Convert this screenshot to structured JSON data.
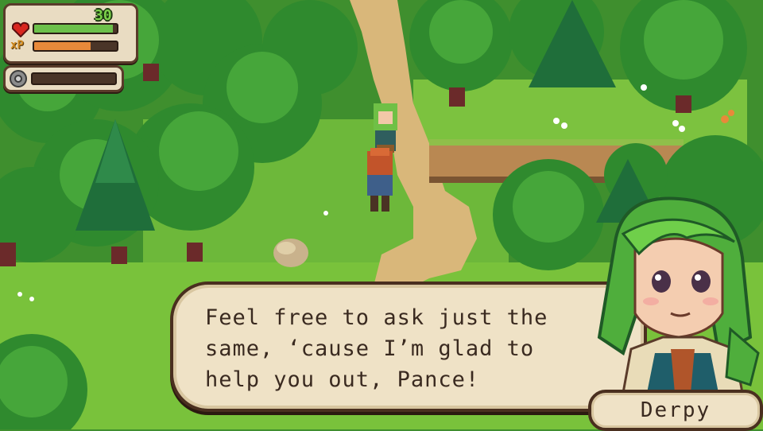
{
  "hud": {
    "hp_value": "30",
    "hp_fraction": 0.95,
    "xp_label": "xP",
    "xp_fraction": 0.68,
    "equip_fraction": 0.0
  },
  "dialog": {
    "text": "Feel free to ask just the\nsame, ‘cause I’m glad to\nhelp you out, Pance!",
    "speaker": "Derpy"
  },
  "colors": {
    "hp_bar": "#6cc04a",
    "xp_bar": "#e8893a",
    "dialog_bg": "#efe2c6",
    "dialog_border": "#4a2f1f",
    "grass": "#5fae33",
    "tree_dark": "#2d7a2a"
  },
  "icons": [
    "heart-icon",
    "xp-icon",
    "gear-icon"
  ]
}
